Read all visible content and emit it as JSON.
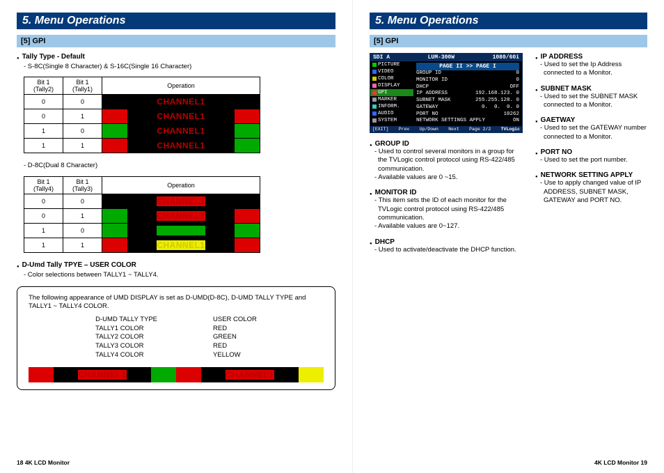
{
  "page_left": {
    "title": "5. Menu Operations",
    "section": "[5] GPI",
    "tally_heading": "Tally Type - Default",
    "tally_sub_s": "- S-8C(Single 8 Character)  & S-16C(Single 16 Character)",
    "tally_sub_d": "- D-8C(Dual 8 Character)",
    "table_s": {
      "head_b1": "Bit 1\n(Tally2)",
      "head_b2": "Bit 1\n(Tally1)",
      "head_op": "Operation",
      "rows": [
        {
          "b1": "0",
          "b2": "0",
          "left": "black",
          "right": "black"
        },
        {
          "b1": "0",
          "b2": "1",
          "left": "red",
          "right": "red"
        },
        {
          "b1": "1",
          "b2": "0",
          "left": "green",
          "right": "green"
        },
        {
          "b1": "1",
          "b2": "1",
          "left": "red",
          "right": "green"
        }
      ]
    },
    "table_d": {
      "head_b1": "Bit 1\n(Tally4)",
      "head_b2": "Bit 1\n(Tally3)",
      "head_op": "Operation",
      "rows": [
        {
          "b1": "0",
          "b2": "0",
          "left": "black",
          "right": "black",
          "label": "red"
        },
        {
          "b1": "0",
          "b2": "1",
          "left": "green",
          "right": "red",
          "label": "red"
        },
        {
          "b1": "1",
          "b2": "0",
          "left": "green",
          "right": "green",
          "label": "green"
        },
        {
          "b1": "1",
          "b2": "1",
          "left": "red",
          "right": "red",
          "label": "yellow"
        }
      ]
    },
    "umd_heading": "D-Umd Tally TPYE – USER COLOR",
    "umd_sub": "- Color selections between TALLY1 ~ TALLY4.",
    "box_intro": "The following appearance of UMD DISPLAY is set as D-UMD(D-8C), D-UMD TALLY TYPE and TALLY1 ~ TALLY4 COLOR.",
    "box_left": [
      "D-UMD TALLY TYPE",
      "TALLY1 COLOR",
      "TALLY2 COLOR",
      "TALLY3 COLOR",
      "TALLY4 COLOR"
    ],
    "box_right": [
      "USER COLOR",
      "RED",
      "GREEN",
      "RED",
      "YELLOW"
    ],
    "big_bar": {
      "blocks": [
        {
          "tl": "red",
          "tr": "green",
          "label": "red"
        },
        {
          "tl": "red",
          "tr": "yellow",
          "label": "red"
        }
      ]
    },
    "footer": "18  4K LCD Monitor"
  },
  "page_right": {
    "title": "5. Menu Operations",
    "section": "[5] GPI",
    "osd": {
      "top_left": "SDI A",
      "top_mid": "LUM-300W",
      "top_right": "1080/60i",
      "page_row": "PAGE II >> PAGE I",
      "side": [
        {
          "c": "c-gr",
          "t": "PICTURE"
        },
        {
          "c": "c-bl",
          "t": "VIDEO"
        },
        {
          "c": "c-yl",
          "t": "COLOR"
        },
        {
          "c": "c-pk",
          "t": "DISPLAY"
        },
        {
          "c": "c-rd",
          "t": "GPI",
          "sel": true
        },
        {
          "c": "c-gy",
          "t": "MARKER"
        },
        {
          "c": "c-cy",
          "t": "INFORM."
        },
        {
          "c": "c-bl",
          "t": "AUDIO"
        },
        {
          "c": "c-gy",
          "t": "SYSTEM"
        }
      ],
      "rows": [
        {
          "k": "GROUP ID",
          "v": "0"
        },
        {
          "k": "MONITOR ID",
          "v": "0"
        },
        {
          "k": "DHCP",
          "v": "OFF"
        },
        {
          "k": "IP ADDRESS",
          "v": "192.168.123. 0"
        },
        {
          "k": "SUBNET MASK",
          "v": "255.255.128. 0"
        },
        {
          "k": "GATEWAY",
          "v": "0.  0.  0. 0"
        },
        {
          "k": "PORT NO",
          "v": "10262"
        },
        {
          "k": "NETWORK SETTINGS APPLY",
          "v": "ON"
        }
      ],
      "bottom": [
        "[EXIT]",
        "Prev",
        "Up/Down",
        "Next",
        "Page 2/2",
        "TVLogic"
      ]
    },
    "left_defs": [
      {
        "t": "GROUP ID",
        "d": [
          "- Used to control several monitors in a group for the TVLogic control protocol using RS-422/485 communication.",
          "- Available values are 0 ~15."
        ]
      },
      {
        "t": "MONITOR ID",
        "d": [
          "- This item sets the ID of each monitor for the TVLogic control protocol using RS-422/485 communication.",
          "- Available values are 0~127."
        ]
      },
      {
        "t": "DHCP",
        "d": [
          "- Used to activate/deactivate the DHCP function."
        ]
      }
    ],
    "right_defs": [
      {
        "t": "IP ADDRESS",
        "d": [
          "- Used to set the Ip Address connected to a Monitor."
        ]
      },
      {
        "t": "SUBNET MASK",
        "d": [
          "- Used to set the SUBNET MASK connected to a Monitor."
        ]
      },
      {
        "t": "GAETWAY",
        "d": [
          "- Used to set the GATEWAY number connected to a Monitor."
        ]
      },
      {
        "t": "PORT NO",
        "d": [
          "- Used to set the port number."
        ]
      },
      {
        "t": "NETWORK SETTING APPLY",
        "d": [
          "- Use to apply changed value of IP ADDRESS, SUBNET MASK, GATEWAY and PORT NO."
        ]
      }
    ],
    "footer": "4K LCD Monitor  19"
  },
  "channel_label": "CHANNEL1"
}
